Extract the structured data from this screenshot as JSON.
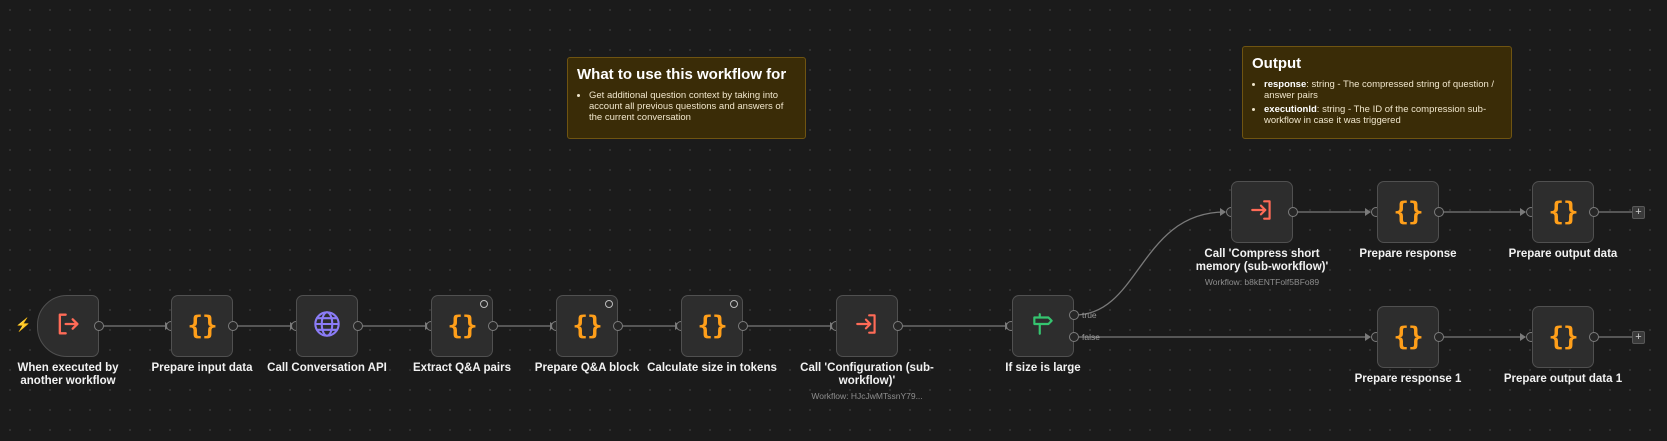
{
  "notes": {
    "what_for": {
      "title": "What to use this workflow for",
      "bullets": [
        "Get additional question context by taking into account all previous questions and answers of the current conversation"
      ]
    },
    "output": {
      "title": "Output",
      "items": [
        {
          "name": "response",
          "desc": ": string - The compressed string of question / answer pairs"
        },
        {
          "name": "executionId",
          "desc": ": string - The ID of the compression sub-workflow in case it was triggered"
        }
      ]
    }
  },
  "nodes": {
    "trigger": {
      "label": "When executed by another workflow"
    },
    "prepare_input": {
      "label": "Prepare input data"
    },
    "call_api": {
      "label": "Call Conversation API"
    },
    "extract_qa": {
      "label": "Extract Q&A pairs"
    },
    "prepare_qa": {
      "label": "Prepare Q&A block"
    },
    "calc_size": {
      "label": "Calculate size in tokens"
    },
    "call_config": {
      "label": "Call 'Configuration (sub-workflow)'",
      "sub": "Workflow: HJcJwMTssnY79..."
    },
    "if_large": {
      "label": "If size is large",
      "true_label": "true",
      "false_label": "false"
    },
    "call_compress": {
      "label": "Call 'Compress short memory (sub-workflow)'",
      "sub": "Workflow: b8kENTFolf5BFo89"
    },
    "prepare_response": {
      "label": "Prepare response"
    },
    "prepare_output": {
      "label": "Prepare output data"
    },
    "prepare_response_1": {
      "label": "Prepare response 1"
    },
    "prepare_output_1": {
      "label": "Prepare output data 1"
    }
  },
  "icons": {
    "code": "{}",
    "plus": "+",
    "bolt": "⚡"
  },
  "colors": {
    "code_icon": "#ff9f1a",
    "exec_icon": "#ff6b57",
    "http_icon": "#8b7cf6",
    "if_icon": "#35c46f",
    "sticky_bg": "#3a2c07"
  }
}
